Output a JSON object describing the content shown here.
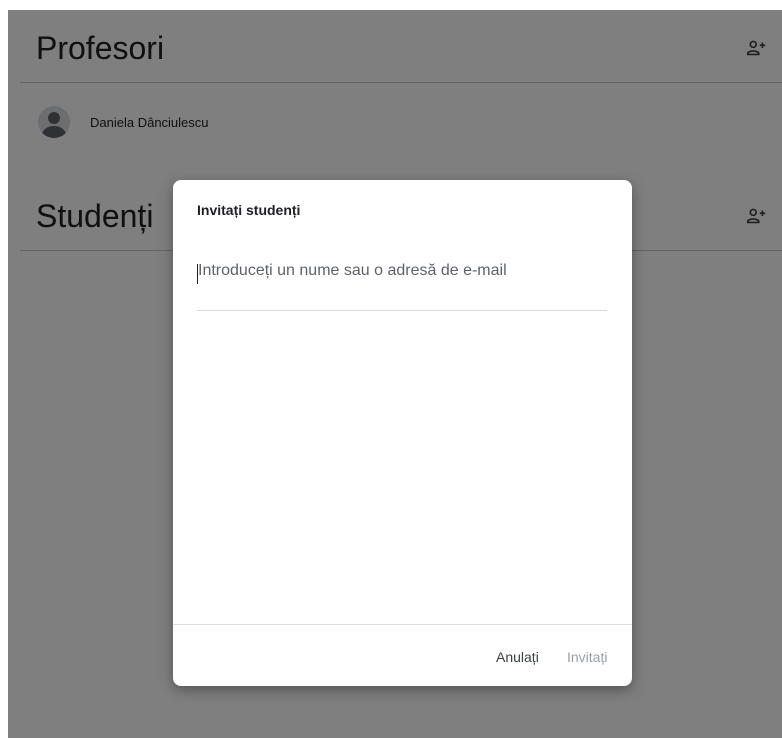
{
  "teachers": {
    "title": "Profesori",
    "add_icon": "person-add-icon",
    "list": [
      {
        "name": "Daniela Dânciulescu",
        "avatar": "default-avatar"
      }
    ]
  },
  "students": {
    "title": "Studenți",
    "add_icon": "person-add-icon"
  },
  "dialog": {
    "title": "Invitați studenți",
    "input_placeholder": "Introduceți un nume sau o adresă de e-mail",
    "input_value": "",
    "cancel_label": "Anulați",
    "invite_label": "Invitați"
  },
  "colors": {
    "scrim": "#000000",
    "text_primary": "#202124",
    "disabled": "#9aa0a6"
  }
}
